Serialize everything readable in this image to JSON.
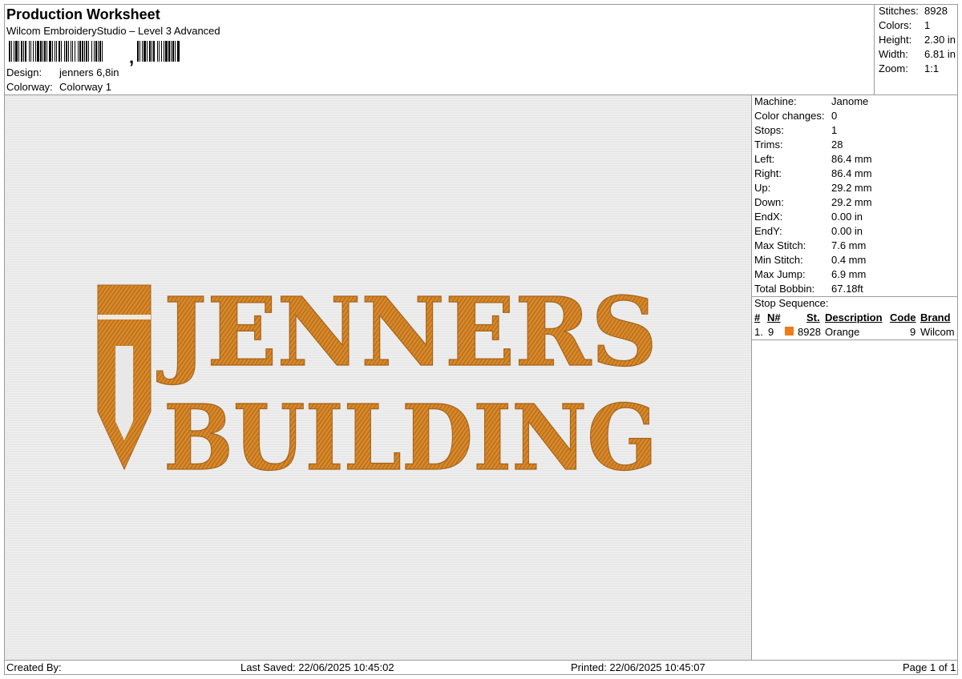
{
  "header": {
    "title": "Production Worksheet",
    "subtitle": "Wilcom EmbroideryStudio – Level 3 Advanced",
    "design_label": "Design:",
    "design_value": "jenners 6,8in",
    "colorway_label": "Colorway:",
    "colorway_value": "Colorway 1"
  },
  "summary": [
    {
      "label": "Stitches:",
      "value": "8928"
    },
    {
      "label": "Colors:",
      "value": "1"
    },
    {
      "label": "Height:",
      "value": "2.30 in"
    },
    {
      "label": "Width:",
      "value": "6.81 in"
    },
    {
      "label": "Zoom:",
      "value": "1:1"
    }
  ],
  "stats": [
    {
      "label": "Machine:",
      "value": "Janome"
    },
    {
      "label": "Color changes:",
      "value": "0"
    },
    {
      "label": "Stops:",
      "value": "1"
    },
    {
      "label": "Trims:",
      "value": "28"
    },
    {
      "label": "Left:",
      "value": "86.4 mm"
    },
    {
      "label": "Right:",
      "value": "86.4 mm"
    },
    {
      "label": "Up:",
      "value": "29.2 mm"
    },
    {
      "label": "Down:",
      "value": "29.2 mm"
    },
    {
      "label": "EndX:",
      "value": "0.00 in"
    },
    {
      "label": "EndY:",
      "value": "0.00 in"
    },
    {
      "label": "Max Stitch:",
      "value": "7.6 mm"
    },
    {
      "label": "Min Stitch:",
      "value": "0.4 mm"
    },
    {
      "label": "Max Jump:",
      "value": "6.9 mm"
    },
    {
      "label": "Total Bobbin:",
      "value": "67.18ft"
    }
  ],
  "stop_sequence": {
    "title": "Stop Sequence:",
    "headers": {
      "index": "#",
      "num": "N#",
      "stitches": "St.",
      "description": "Description",
      "code": "Code",
      "brand": "Brand"
    },
    "rows": [
      {
        "index": "1.",
        "num": "9",
        "stitches": "8928",
        "description": "Orange",
        "code": "9",
        "brand": "Wilcom",
        "color": "#ee7c1b"
      }
    ]
  },
  "design": {
    "line1": "JENNERS",
    "line2": "BUILDING",
    "thread_color": "#d9892a"
  },
  "footer": {
    "created_by": "Created By:",
    "last_saved": "Last Saved: 22/06/2025 10:45:02",
    "printed": "Printed: 22/06/2025 10:45:07",
    "page": "Page 1 of 1"
  }
}
